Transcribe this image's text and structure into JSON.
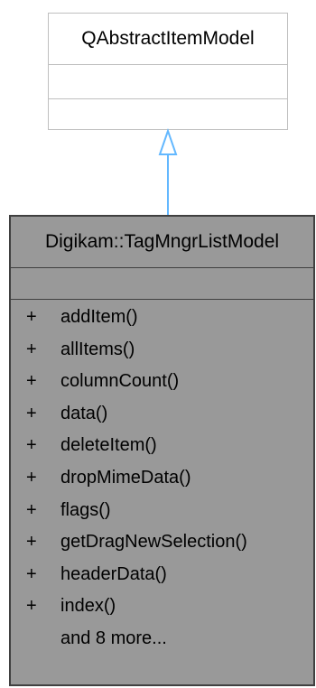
{
  "parent_class": {
    "name": "QAbstractItemModel"
  },
  "main_class": {
    "name": "Digikam::TagMngrListModel",
    "methods": [
      {
        "visibility": "+",
        "name": "addItem()"
      },
      {
        "visibility": "+",
        "name": "allItems()"
      },
      {
        "visibility": "+",
        "name": "columnCount()"
      },
      {
        "visibility": "+",
        "name": "data()"
      },
      {
        "visibility": "+",
        "name": "deleteItem()"
      },
      {
        "visibility": "+",
        "name": "dropMimeData()"
      },
      {
        "visibility": "+",
        "name": "flags()"
      },
      {
        "visibility": "+",
        "name": "getDragNewSelection()"
      },
      {
        "visibility": "+",
        "name": "headerData()"
      },
      {
        "visibility": "+",
        "name": "index()"
      }
    ],
    "more_label": "and 8 more..."
  },
  "colors": {
    "parent_border": "#bfbfbf",
    "main_fill": "#999999",
    "main_border": "#404040",
    "arrow": "#63b8ff"
  }
}
